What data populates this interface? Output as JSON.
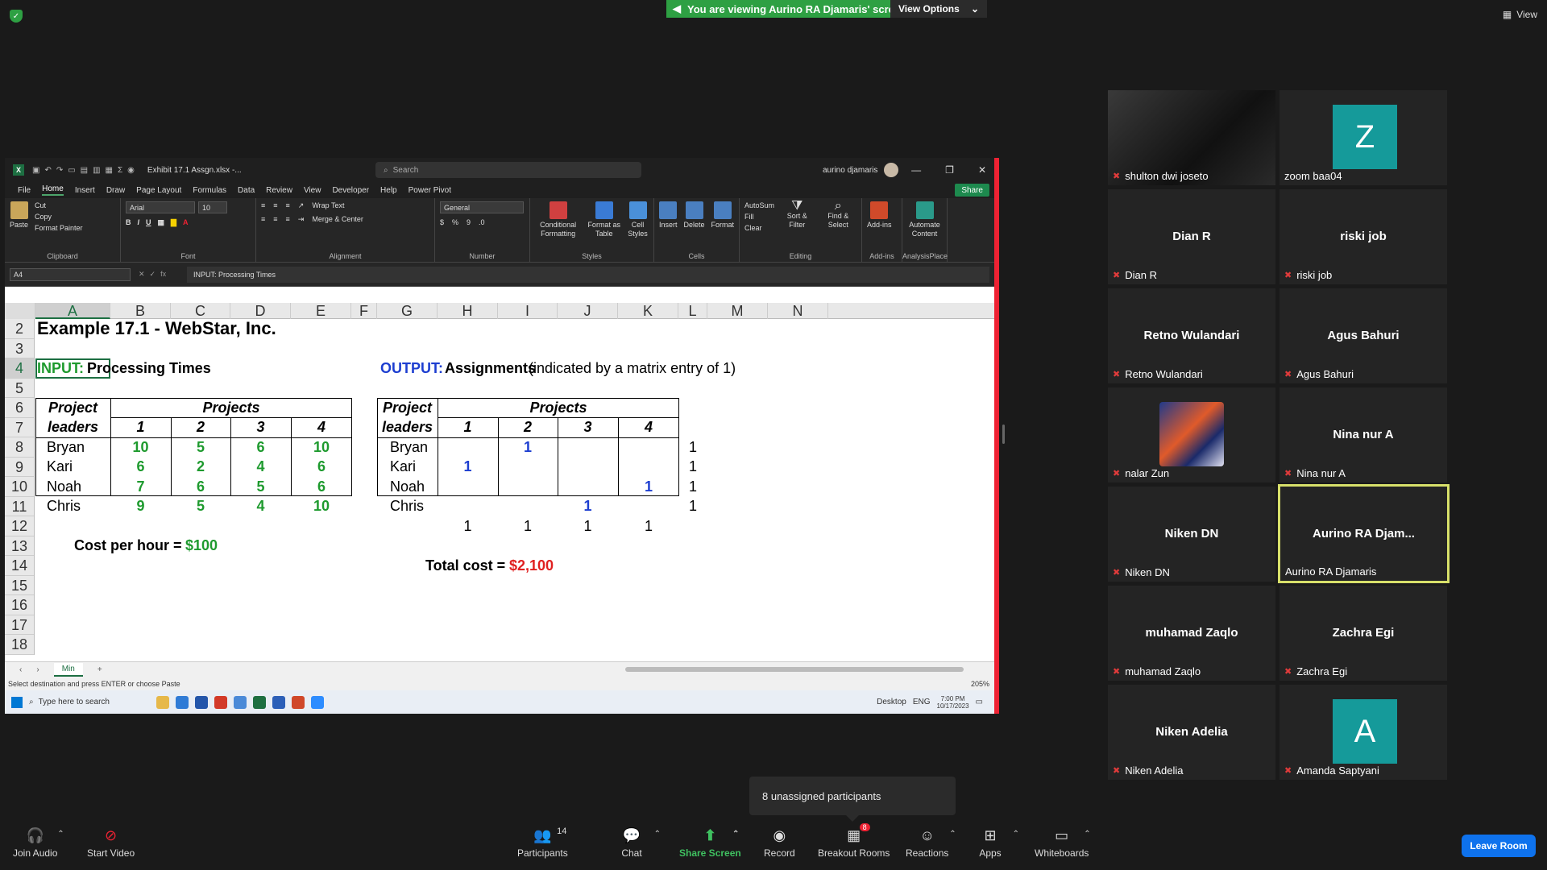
{
  "banner": {
    "viewing_text": "You are viewing Aurino RA Djamaris' screen",
    "view_options": "View Options",
    "view_label": "View"
  },
  "excel": {
    "filename": "Exhibit 17.1 Assgn.xlsx  -...",
    "search_placeholder": "Search",
    "user_name": "aurino djamaris",
    "tabs": [
      "File",
      "Home",
      "Insert",
      "Draw",
      "Page Layout",
      "Formulas",
      "Data",
      "Review",
      "View",
      "Developer",
      "Help",
      "Power Pivot"
    ],
    "active_tab": "Home",
    "share_label": "Share",
    "ribbon": {
      "paste": "Paste",
      "cut": "Cut",
      "copy": "Copy",
      "format_painter": "Format Painter",
      "clipboard": "Clipboard",
      "font_name": "Arial",
      "font_size": "10",
      "font": "Font",
      "wrap_text": "Wrap Text",
      "merge_center": "Merge & Center",
      "alignment": "Alignment",
      "number_format": "General",
      "number": "Number",
      "conditional_formatting": "Conditional Formatting",
      "format_as_table": "Format as Table",
      "cell_styles": "Cell Styles",
      "styles": "Styles",
      "insert": "Insert",
      "delete": "Delete",
      "format": "Format",
      "cells": "Cells",
      "autosum": "AutoSum",
      "fill": "Fill",
      "clear": "Clear",
      "sort_filter": "Sort & Filter",
      "find_select": "Find & Select",
      "editing": "Editing",
      "add_ins": "Add-ins",
      "addins_group": "Add-ins",
      "automate": "Automate Content",
      "analysis": "AnalysisPlace"
    },
    "name_box": "A4",
    "formula": "INPUT:  Processing Times",
    "columns": [
      "A",
      "B",
      "C",
      "D",
      "E",
      "F",
      "G",
      "H",
      "I",
      "J",
      "K",
      "L",
      "M",
      "N"
    ],
    "rows": [
      "2",
      "3",
      "4",
      "5",
      "6",
      "7",
      "8",
      "9",
      "10",
      "11",
      "12",
      "13",
      "14",
      "15",
      "16",
      "17",
      "18"
    ],
    "sheet": {
      "title": "Example 17.1 - WebStar, Inc.",
      "input_label": "INPUT:",
      "input_title": "Processing Times",
      "output_label": "OUTPUT:",
      "output_title": "Assignments",
      "output_note": "(indicated by a matrix entry of 1)",
      "project_leaders_1": "Project",
      "project_leaders_2": "leaders",
      "projects": "Projects",
      "project_nums": [
        "1",
        "2",
        "3",
        "4"
      ],
      "leaders": [
        "Bryan",
        "Kari",
        "Noah",
        "Chris"
      ],
      "times": [
        [
          "10",
          "5",
          "6",
          "10"
        ],
        [
          "6",
          "2",
          "4",
          "6"
        ],
        [
          "7",
          "6",
          "5",
          "6"
        ],
        [
          "9",
          "5",
          "4",
          "10"
        ]
      ],
      "assignments": [
        [
          "",
          "1",
          "",
          ""
        ],
        [
          "1",
          "",
          "",
          ""
        ],
        [
          "",
          "",
          "",
          "1"
        ],
        [
          "",
          "",
          "1",
          ""
        ]
      ],
      "row_sums": [
        "1",
        "1",
        "1",
        "1"
      ],
      "col_sums": [
        "1",
        "1",
        "1",
        "1"
      ],
      "cost_label": "Cost per hour =",
      "cost_value": "$100",
      "total_label": "Total cost =",
      "total_value": "$2,100"
    },
    "sheet_tab": "Min",
    "status": "Select destination and press ENTER or choose Paste",
    "zoom": "205%",
    "taskbar": {
      "search": "Type here to search",
      "desktop": "Desktop",
      "lang": "ENG",
      "time": "7:00 PM",
      "date": "10/17/2023"
    }
  },
  "participants": [
    {
      "display": "",
      "label": "shulton dwi joseto",
      "kind": "video"
    },
    {
      "display": "Z",
      "label": "zoom baa04",
      "kind": "letter"
    },
    {
      "display": "Dian R",
      "label": "Dian R",
      "kind": "name"
    },
    {
      "display": "riski job",
      "label": "riski job",
      "kind": "name"
    },
    {
      "display": "Retno Wulandari",
      "label": "Retno Wulandari",
      "kind": "name"
    },
    {
      "display": "Agus Bahuri",
      "label": "Agus Bahuri",
      "kind": "name"
    },
    {
      "display": "",
      "label": "nalar Zun",
      "kind": "art"
    },
    {
      "display": "Nina nur A",
      "label": "Nina nur A",
      "kind": "name"
    },
    {
      "display": "Niken DN",
      "label": "Niken DN",
      "kind": "name"
    },
    {
      "display": "Aurino  RA  Djam...",
      "label": "Aurino RA Djamaris",
      "kind": "active"
    },
    {
      "display": "muhamad Zaqlo",
      "label": "muhamad Zaqlo",
      "kind": "name"
    },
    {
      "display": "Zachra Egi",
      "label": "Zachra Egi",
      "kind": "name"
    },
    {
      "display": "Niken Adelia",
      "label": "Niken Adelia",
      "kind": "name"
    },
    {
      "display": "A",
      "label": "Amanda Saptyani",
      "kind": "letter"
    }
  ],
  "tooltip": "8 unassigned participants",
  "toolbar": {
    "join_audio": "Join Audio",
    "start_video": "Start Video",
    "participants": "Participants",
    "participants_count": "14",
    "chat": "Chat",
    "share_screen": "Share Screen",
    "record": "Record",
    "breakout_rooms": "Breakout Rooms",
    "breakout_badge": "8",
    "reactions": "Reactions",
    "apps": "Apps",
    "whiteboards": "Whiteboards",
    "leave_room": "Leave Room"
  },
  "colors": {
    "zoom_green": "#2ea043",
    "zoom_blue": "#0e72ed",
    "excel_green": "#1d6f42",
    "input_green": "#1e9a2e",
    "output_blue": "#1d3ed0",
    "total_red": "#e02020"
  }
}
